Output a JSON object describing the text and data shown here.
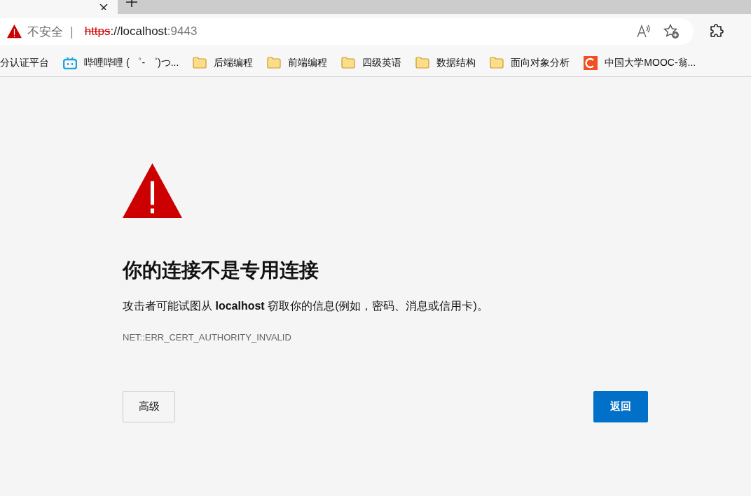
{
  "address_bar": {
    "security": "不安全",
    "separator": "|",
    "scheme": "https",
    "rest": "://localhost",
    "port": ":9443"
  },
  "bookmarks": [
    {
      "kind": "plain",
      "label": "分认证平台"
    },
    {
      "kind": "tv",
      "label": "哔哩哔哩 ( ゜- ゜)つ..."
    },
    {
      "kind": "folder",
      "label": "后端编程"
    },
    {
      "kind": "folder",
      "label": "前端编程"
    },
    {
      "kind": "folder",
      "label": "四级英语"
    },
    {
      "kind": "folder",
      "label": "数据结构"
    },
    {
      "kind": "folder",
      "label": "面向对象分析"
    },
    {
      "kind": "course",
      "label": "中国大学MOOC-翁..."
    }
  ],
  "error": {
    "heading": "你的连接不是专用连接",
    "message": "攻击者可能试图从 **localhost** 窃取你的信息(例如，密码、消息或信用卡)。",
    "code": "NET::ERR_CERT_AUTHORITY_INVALID"
  },
  "buttons": [
    {
      "kind": "secondary",
      "label": "高级"
    },
    {
      "kind": "primary",
      "label": "返回"
    }
  ]
}
